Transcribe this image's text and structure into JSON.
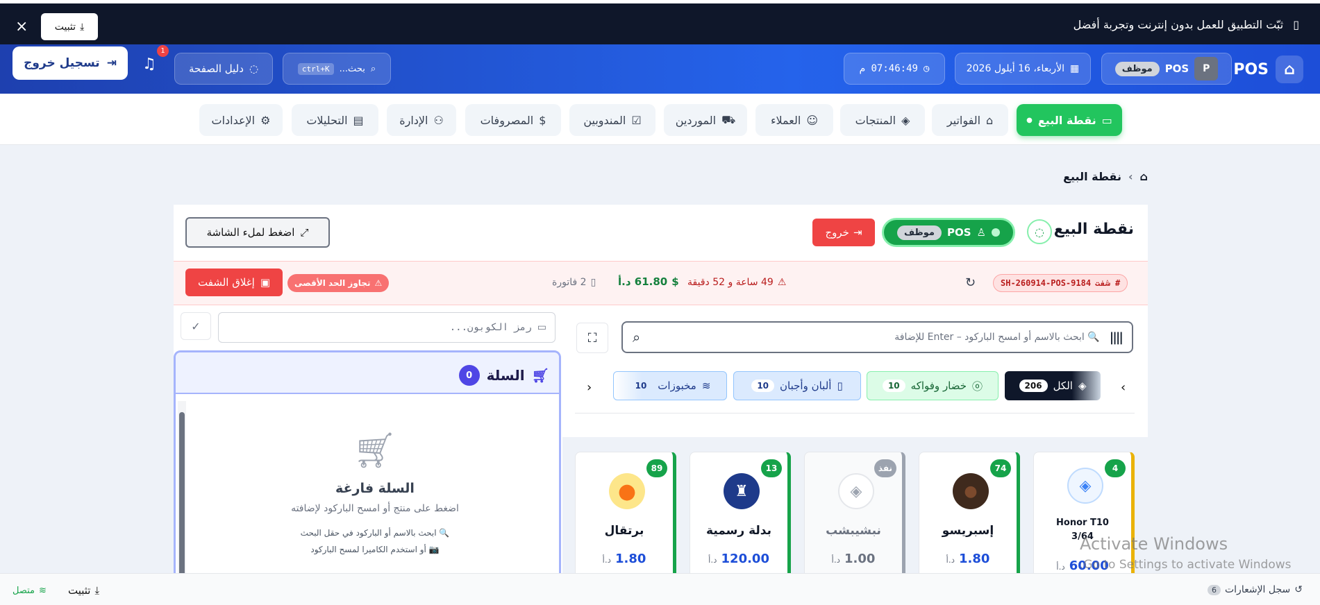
{
  "banner": {
    "message": "ثبّت التطبيق للعمل بدون إنترنت وتجربة أفضل",
    "install": "تثبيت",
    "close": "×"
  },
  "header": {
    "logo": "POS",
    "user_avatar": "P",
    "user_name": "POS",
    "user_role": "موظف",
    "date": "الأربعاء، 16 أيلول 2026",
    "time": "07:46:49 م",
    "search_placeholder": "بحث...",
    "search_shortcut": "ctrl+K",
    "guide": "دليل الصفحة",
    "notifications_count": "1",
    "logout": "تسجيل خروج"
  },
  "nav": {
    "pos": "نقطة البيع",
    "invoices": "الفواتير",
    "products": "المنتجات",
    "customers": "العملاء",
    "suppliers": "الموردين",
    "reps": "المندوبين",
    "expenses": "المصروفات",
    "admin": "الإدارة",
    "analytics": "التحليلات",
    "settings": "الإعدادات"
  },
  "breadcrumb": {
    "current": "نقطة البيع",
    "sep": "›"
  },
  "panel": {
    "title": "نقطة البيع",
    "status_user": "POS",
    "status_role": "موظف",
    "exit": "خروج",
    "fullscreen": "اضغط لملء الشاشة"
  },
  "shift": {
    "id": "SH-260914-POS-9184",
    "id_label": "# شفت",
    "duration": "49 ساعة و 52 دقيقة",
    "amount": "61.80 د.أ",
    "invoices": "2 فاتورة",
    "over_limit": "تجاوز الحد الأقصى",
    "close": "إغلاق الشفت"
  },
  "search": {
    "placeholder": "🔍 ابحث بالاسم أو امسح الباركود – Enter للإضافة"
  },
  "categories": [
    {
      "label": "الكل",
      "count": "206"
    },
    {
      "label": "خضار وفواكه",
      "count": "10"
    },
    {
      "label": "ألبان وأجبان",
      "count": "10"
    },
    {
      "label": "مخبوزات",
      "count": "10"
    }
  ],
  "products": [
    {
      "name": "برتقال",
      "price": "1.80",
      "currency": "د.أ",
      "stock": "89"
    },
    {
      "name": "بدلة رسمية",
      "price": "120.00",
      "currency": "د.أ",
      "stock": "13"
    },
    {
      "name": "نبشيبشب",
      "price": "1.00",
      "currency": "د.أ",
      "stock": "نفذ"
    },
    {
      "name": "إسبريسو",
      "price": "1.80",
      "currency": "د.أ",
      "stock": "74"
    },
    {
      "name": "Honor T10 3/64",
      "price": "60.00",
      "currency": "د.أ",
      "stock": "4"
    }
  ],
  "coupon": {
    "placeholder": "رمز الكوبون..."
  },
  "cart": {
    "title": "السلة",
    "count": "0",
    "empty_title": "السلة فارغة",
    "empty_sub": "اضغط على منتج أو امسح الباركود لإضافته",
    "hint1": "🔍 ابحث بالاسم أو الباركود في حقل البحث",
    "hint2": "📷 أو استخدم الكاميرا لمسح الباركود"
  },
  "watermark": {
    "line1": "Activate Windows",
    "line2": "Go to Settings to activate Windows."
  },
  "bottom": {
    "log": "سجل الإشعارات",
    "log_count": "6",
    "install": "تثبيت",
    "connected": "متصل"
  },
  "colors": {
    "primary": "#2563eb",
    "accent_green": "#22c55e",
    "danger": "#ef4444",
    "dark": "#0f172a"
  }
}
